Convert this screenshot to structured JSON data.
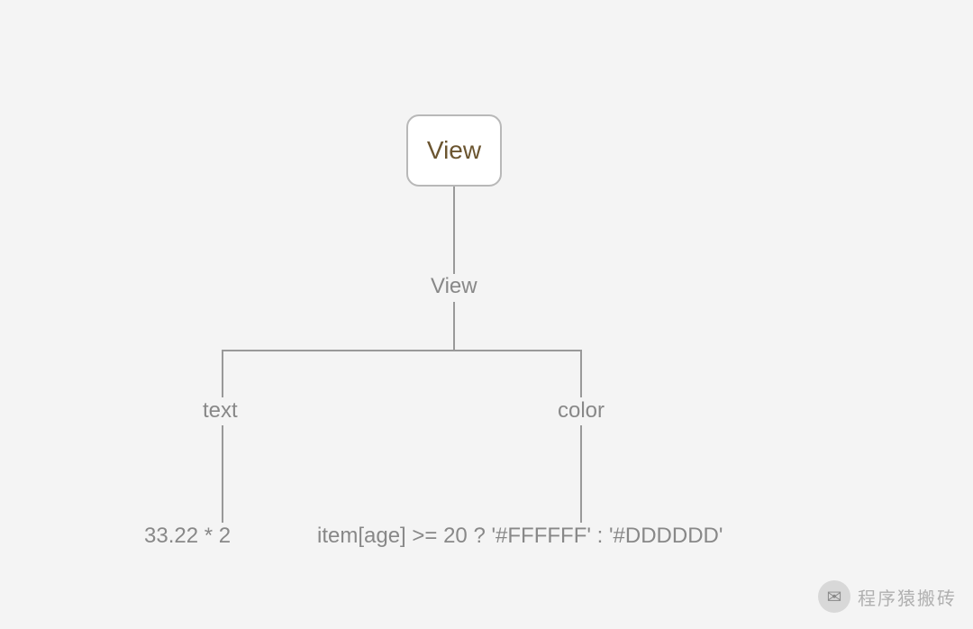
{
  "diagram": {
    "root": "View",
    "node_view": "View",
    "branch_left_label": "text",
    "branch_right_label": "color",
    "leaf_left": "33.22 * 2",
    "leaf_right": "item[age] >= 20 ? '#FFFFFF' : '#DDDDDD'"
  },
  "watermark": {
    "text": "程序猿搬砖",
    "icon_glyph": "✉"
  }
}
